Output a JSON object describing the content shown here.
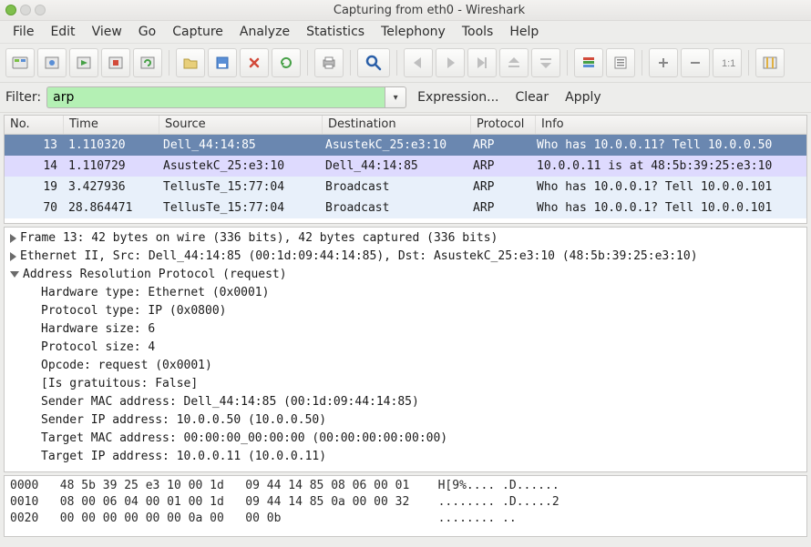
{
  "window": {
    "title": "Capturing from eth0  -  Wireshark"
  },
  "menu": [
    "File",
    "Edit",
    "View",
    "Go",
    "Capture",
    "Analyze",
    "Statistics",
    "Telephony",
    "Tools",
    "Help"
  ],
  "toolbar_icons": [
    "interfaces-icon",
    "capture-options-icon",
    "start-capture-icon",
    "stop-capture-icon",
    "restart-capture-icon",
    "sep",
    "open-icon",
    "save-icon",
    "close-icon",
    "reload-icon",
    "sep",
    "print-icon",
    "sep",
    "find-icon",
    "sep",
    "go-back-icon",
    "go-forward-icon",
    "go-to-icon",
    "go-first-icon",
    "go-last-icon",
    "sep",
    "colorize-icon",
    "auto-scroll-icon",
    "sep",
    "zoom-in-icon",
    "zoom-out-icon",
    "zoom-reset-icon",
    "sep",
    "resize-columns-icon"
  ],
  "filter": {
    "label": "Filter:",
    "value": "arp",
    "expression": "Expression...",
    "clear": "Clear",
    "apply": "Apply"
  },
  "columns": {
    "no": "No.",
    "time": "Time",
    "src": "Source",
    "dst": "Destination",
    "proto": "Protocol",
    "info": "Info"
  },
  "packets": [
    {
      "no": "13",
      "time": "1.110320",
      "src": "Dell_44:14:85",
      "dst": "AsustekC_25:e3:10",
      "proto": "ARP",
      "info": "Who has 10.0.0.11?  Tell 10.0.0.50",
      "style": "sel"
    },
    {
      "no": "14",
      "time": "1.110729",
      "src": "AsustekC_25:e3:10",
      "dst": "Dell_44:14:85",
      "proto": "ARP",
      "info": "10.0.0.11 is at 48:5b:39:25:e3:10",
      "style": "arp2"
    },
    {
      "no": "19",
      "time": "3.427936",
      "src": "TellusTe_15:77:04",
      "dst": "Broadcast",
      "proto": "ARP",
      "info": "Who has 10.0.0.1?  Tell 10.0.0.101",
      "style": "bcast"
    },
    {
      "no": "70",
      "time": "28.864471",
      "src": "TellusTe_15:77:04",
      "dst": "Broadcast",
      "proto": "ARP",
      "info": "Who has 10.0.0.1?  Tell 10.0.0.101",
      "style": "bcast"
    }
  ],
  "details": {
    "frame": "Frame 13: 42 bytes on wire (336 bits), 42 bytes captured (336 bits)",
    "ethernet": "Ethernet II, Src: Dell_44:14:85 (00:1d:09:44:14:85), Dst: AsustekC_25:e3:10 (48:5b:39:25:e3:10)",
    "arp": "Address Resolution Protocol (request)",
    "fields": [
      "Hardware type: Ethernet (0x0001)",
      "Protocol type: IP (0x0800)",
      "Hardware size: 6",
      "Protocol size: 4",
      "Opcode: request (0x0001)",
      "[Is gratuitous: False]",
      "Sender MAC address: Dell_44:14:85 (00:1d:09:44:14:85)",
      "Sender IP address: 10.0.0.50 (10.0.0.50)",
      "Target MAC address: 00:00:00_00:00:00 (00:00:00:00:00:00)",
      "Target IP address: 10.0.0.11 (10.0.0.11)"
    ]
  },
  "bytes": [
    "0000   48 5b 39 25 e3 10 00 1d   09 44 14 85 08 06 00 01    H[9%.... .D......",
    "0010   08 00 06 04 00 01 00 1d   09 44 14 85 0a 00 00 32    ........ .D.....2",
    "0020   00 00 00 00 00 00 0a 00   00 0b                      ........ .."
  ]
}
